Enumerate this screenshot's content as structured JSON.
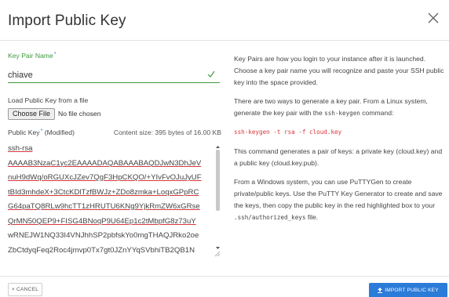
{
  "dialog": {
    "title": "Import Public Key",
    "close_icon": "close-icon"
  },
  "form": {
    "key_pair_name_label": "Key Pair Name",
    "required_marker": "*",
    "key_pair_name_value": "chiave",
    "load_label": "Load Public Key from a file",
    "choose_file_label": "Choose File",
    "no_file_text": "No file chosen",
    "public_key_label": "Public Key",
    "public_key_state": " (Modified)",
    "content_size": "Content size: 395 bytes of 16.00 KB",
    "key_lines": [
      {
        "text": "ssh-rsa",
        "flagged": true
      },
      {
        "text": "AAAAB3NzaC1yc2EAAAADAQABAAABAQDJwN3DhJeV",
        "flagged": true
      },
      {
        "text": "nuH9dWq/oRGUXcJZev7QgF3HpCKQO/+YIvFvOJuJyUF",
        "flagged": true
      },
      {
        "text": "tBId3mhdeX+3CtcKDlTzfBWJz+ZDo8zmka+LoqxGPpRC",
        "flagged": true
      },
      {
        "text": "G64paTQ8RLw9hcTT1zHRUTU6KNg9YjkRmZW6xGRse",
        "flagged": true
      },
      {
        "text": "QrMN50QEP9+FISG4BNoqP9U64Ep1c2tMbpfG8z73uY",
        "flagged": true
      },
      {
        "text": "wRNEJW1NQ33I4VNJhhSP2pbfskYo0mgTHAQJRko2oe",
        "flagged": false
      },
      {
        "text": "ZbCtdyqFeq2Roc4jmvp0Tx7gt0JZnYYqSVbhiTB2QB1N",
        "flagged": false
      }
    ]
  },
  "help": {
    "p1": "Key Pairs are how you login to your instance after it is launched. Choose a key pair name you will recognize and paste your SSH public key into the space provided.",
    "p2_prefix": "There are two ways to generate a key pair. From a Linux system, generate the key pair with the ",
    "p2_code": "ssh-keygen",
    "p2_suffix": " command:",
    "command": "ssh-keygen -t rsa -f cloud.key",
    "p3": "This command generates a pair of keys: a private key (cloud.key) and a public key (cloud.key.pub).",
    "p4_prefix": "From a Windows system, you can use PuTTYGen to create private/public keys. Use the PuTTY Key Generator to create and save the keys, then copy the public key in the red highlighted box to your ",
    "p4_code": ".ssh/authorized_keys",
    "p4_suffix": " file."
  },
  "footer": {
    "cancel_label": "× CANCEL",
    "import_label": "IMPORT PUBLIC KEY"
  },
  "colors": {
    "accent_green": "#3d9a3d",
    "primary_blue": "#2b7bd8",
    "error_red": "#d9373c"
  }
}
